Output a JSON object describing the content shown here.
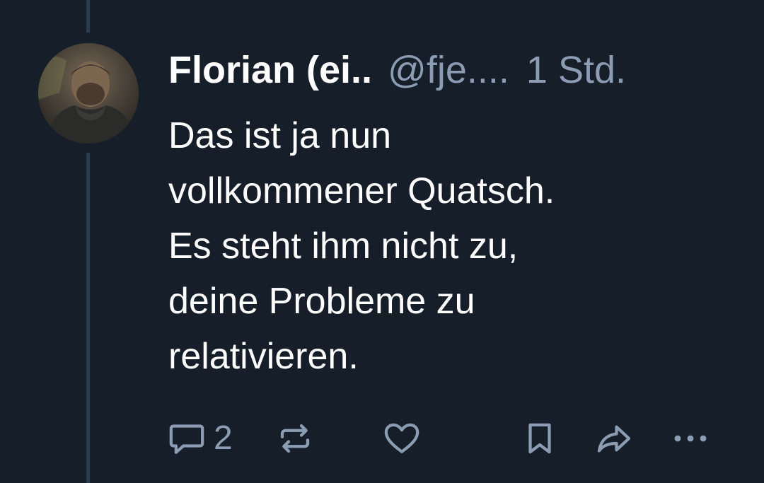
{
  "post": {
    "author": {
      "display_name": "Florian (ei..",
      "handle": "@fje....",
      "avatar_icon": "user-photo-avatar"
    },
    "timestamp": "1 Std.",
    "text_lines": [
      "Das ist ja nun",
      "vollkommener Quatsch.",
      "Es steht ihm nicht zu,",
      "deine Probleme zu",
      "relativieren."
    ],
    "actions": {
      "reply": {
        "icon": "speech-bubble-icon",
        "count": "2"
      },
      "repost": {
        "icon": "repost-arrows-icon"
      },
      "like": {
        "icon": "heart-icon"
      },
      "bookmark": {
        "icon": "bookmark-icon"
      },
      "share": {
        "icon": "share-arrow-icon"
      },
      "more": {
        "icon": "ellipsis-icon"
      }
    }
  },
  "colors": {
    "background": "#161e29",
    "thread_line": "#2c3a4d",
    "primary_text": "#ffffff",
    "secondary_text": "#8b9cb3"
  }
}
